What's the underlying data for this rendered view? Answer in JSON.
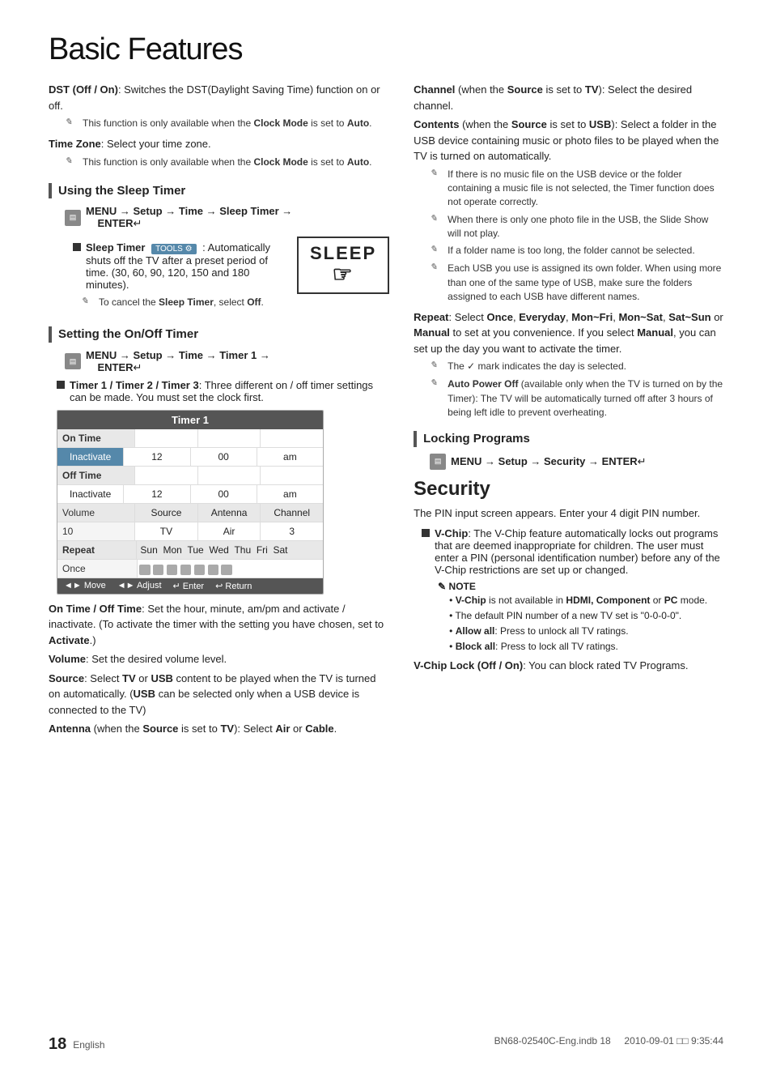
{
  "page": {
    "title": "Basic Features",
    "footer_page_num": "18",
    "footer_lang": "English",
    "footer_file": "BN68-02540C-Eng.indb   18",
    "footer_date": "2010-09-01   □□ 9:35:44"
  },
  "left_col": {
    "dst_label": "DST (Off / On)",
    "dst_text": ": Switches the DST(Daylight Saving Time) function on or off.",
    "dst_note": "This function is only available when the Clock Mode is set to Auto.",
    "timezone_label": "Time Zone",
    "timezone_text": ": Select your time zone.",
    "timezone_note": "This function is only available when the Clock Mode is set to Auto.",
    "sleep_section": "Using the Sleep Timer",
    "sleep_menu": "MENU  → Setup → Time → Sleep Timer → ENTER",
    "sleep_bullet_label": "Sleep Timer",
    "sleep_bullet_text": " : Automatically shuts off the TV after a preset period of time. (30, 60, 90, 120, 150 and 180 minutes).",
    "sleep_note": "To cancel the Sleep Timer, select Off.",
    "sleep_box_text": "SLEEP",
    "ontimer_section": "Setting the On/Off Timer",
    "ontimer_menu": "MENU  → Setup → Time → Timer 1 → ENTER",
    "timer_bullet_text": "Timer 1 / Timer 2 / Timer 3: Three different on / off timer settings can be made. You must set the clock first.",
    "timer_title": "Timer 1",
    "timer_rows": [
      {
        "label": "On Time",
        "cells": [
          "",
          "",
          ""
        ]
      },
      {
        "label": "",
        "cells": [
          "Inactivate",
          "12",
          "00",
          "am"
        ]
      },
      {
        "label": "Off Time",
        "cells": [
          "",
          "",
          ""
        ]
      },
      {
        "label": "",
        "cells": [
          "Inactivate",
          "12",
          "00",
          "am"
        ]
      },
      {
        "label": "Volume",
        "cells": [
          "Source",
          "Antenna",
          "Channel"
        ]
      },
      {
        "label": "",
        "cells": [
          "10",
          "TV",
          "Air",
          "3"
        ]
      }
    ],
    "repeat_label": "Repeat",
    "repeat_once": "Once",
    "days": [
      "Sun",
      "Mon",
      "Tue",
      "Wed",
      "Thu",
      "Fri",
      "Sat"
    ],
    "nav_move": "◄► Move",
    "nav_adjust": "◄► Adjust",
    "nav_enter": "↵ Enter",
    "nav_return": "↩ Return",
    "ontime_label": "On Time / Off Time",
    "ontime_text": ": Set the hour, minute, am/pm and activate / inactivate. (To activate the timer with the setting you have chosen, set to Activate.)",
    "volume_label": "Volume",
    "volume_text": ": Set the desired volume level.",
    "source_label": "Source",
    "source_text": ": Select TV or USB content to be played when the TV is turned on automatically. (USB can be selected only when a USB device is connected to the TV)",
    "antenna_label": "Antenna",
    "antenna_text_pre": " (when the ",
    "antenna_source": "Source",
    "antenna_text_mid": " is set to ",
    "antenna_tv": "TV",
    "antenna_text_post": "): Select Air or Cable."
  },
  "right_col": {
    "channel_label": "Channel",
    "channel_text_pre": " (when the ",
    "channel_source": "Source",
    "channel_text_mid": " is set to ",
    "channel_tv": "TV",
    "channel_text_post": "): Select the desired channel.",
    "contents_label": "Contents",
    "contents_text_pre": " (when the ",
    "contents_source": "Source",
    "contents_text_mid": " is set to ",
    "contents_usb": "USB",
    "contents_text_post": "): Select a folder in the USB device containing music or photo files to be played when the TV is turned on automatically.",
    "notes_right": [
      "If there is no music file on the USB device or the folder containing a music file is not selected, the Timer function does not operate correctly.",
      "When there is only one photo file in the USB, the Slide Show will not play.",
      "If a folder name is too long, the folder cannot be selected.",
      "Each USB you use is assigned its own folder. When using more than one of the same type of USB, make sure the folders assigned to each USB have different names."
    ],
    "repeat_label": "Repeat",
    "repeat_text": ": Select Once, Everyday, Mon~Fri, Mon~Sat, Sat~Sun or Manual to set at you convenience. If you select Manual, you can set up the day you want to activate the timer.",
    "repeat_note": "The ✓ mark indicates the day is selected.",
    "autopower_label": "Auto Power Off",
    "autopower_text": " (available only when the TV is turned on by the Timer): The TV will be automatically turned off after 3 hours of being left idle to prevent overheating.",
    "locking_section": "Locking Programs",
    "locking_menu": "MENU  → Setup → Security → ENTER",
    "security_title": "Security",
    "security_intro": "The PIN input screen appears. Enter your 4 digit PIN number.",
    "vchip_label": "V-Chip",
    "vchip_text": ": The V-Chip feature automatically locks out programs that are deemed inappropriate for children. The user must enter a PIN (personal identification number) before any of the V-Chip restrictions are set up or changed.",
    "note_label": "NOTE",
    "note_bullets": [
      "V-Chip is not available in HDMI, Component or PC mode.",
      "The default PIN number of a new TV set is \"0-0-0-0\".",
      "Allow all: Press to unlock all TV ratings.",
      "Block all: Press to lock all TV ratings."
    ],
    "vchip_lock_label": "V-Chip Lock (Off / On)",
    "vchip_lock_text": ": You can block rated TV Programs."
  }
}
